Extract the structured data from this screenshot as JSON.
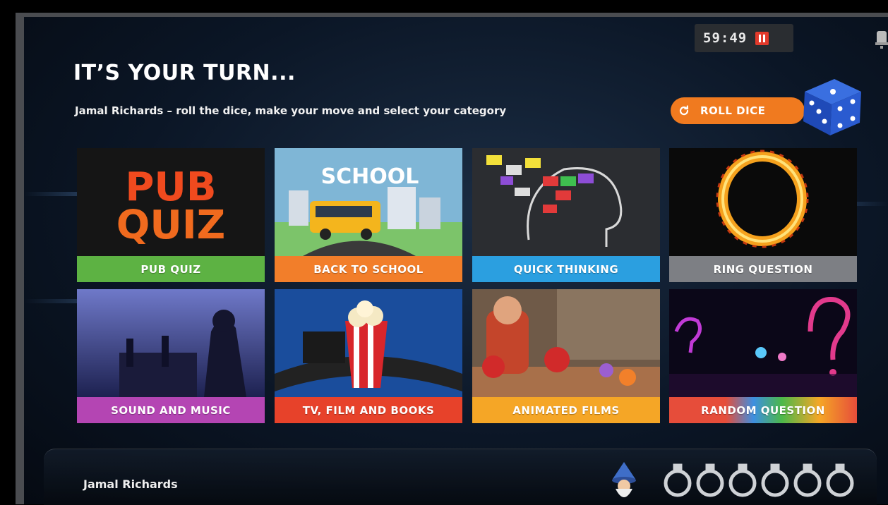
{
  "header": {
    "title": "IT’S YOUR TURN...",
    "subtitle": "Jamal Richards – roll the dice, make your move and select your category",
    "timer": "59:49"
  },
  "roll_button": {
    "label": "ROLL DICE"
  },
  "categories": [
    {
      "label": "PUB QUIZ",
      "color": "#5db243",
      "art_text": [
        "PUB",
        "QUIZ"
      ]
    },
    {
      "label": "BACK TO SCHOOL",
      "color": "#f27e2a",
      "art_text": [
        "SCHOOL"
      ]
    },
    {
      "label": "QUICK THINKING",
      "color": "#2b9fe0"
    },
    {
      "label": "RING QUESTION",
      "color": "#7d7f84"
    },
    {
      "label": "SOUND AND MUSIC",
      "color": "#b445b3"
    },
    {
      "label": "TV, FILM AND BOOKS",
      "color": "#e7422a"
    },
    {
      "label": "ANIMATED FILMS",
      "color": "#f5a626"
    },
    {
      "label": "RANDOM QUESTION",
      "color": "#e64d3a"
    }
  ],
  "footer": {
    "player_name": "Jamal Richards",
    "tokens_count": 6
  },
  "icons": {
    "pause": "pause-icon",
    "roll": "refresh-icon",
    "dice": "dice-icon",
    "avatar": "wizard-avatar-icon",
    "token": "empty-token-icon"
  }
}
